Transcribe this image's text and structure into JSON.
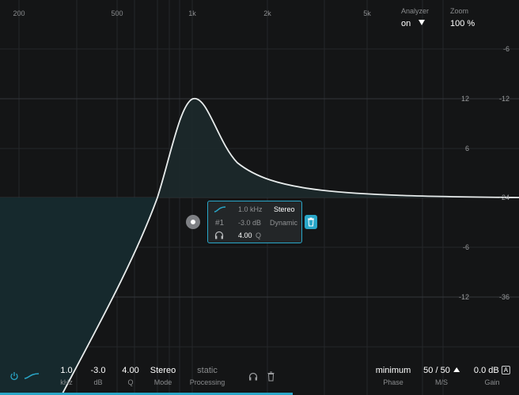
{
  "freq_labels": [
    "200",
    "500",
    "1k",
    "2k",
    "5k"
  ],
  "db_inner": [
    "12",
    "6",
    "-6",
    "-12"
  ],
  "db_outer": [
    "-6",
    "-12",
    "-24",
    "-36"
  ],
  "analyzer": {
    "label": "Analyzer",
    "value": "on"
  },
  "zoom": {
    "label": "Zoom",
    "value": "100 %"
  },
  "band": {
    "freq": "1.0 kHz",
    "channel": "Stereo",
    "index": "#1",
    "gain": "-3.0 dB",
    "mode": "Dynamic",
    "q_value": "4.00",
    "q_label": "Q"
  },
  "bottom": {
    "freq_value": "1.0",
    "freq_label": "kHz",
    "gain_value": "-3.0",
    "gain_label": "dB",
    "q_value": "4.00",
    "q_label": "Q",
    "mode_value": "Stereo",
    "mode_label": "Mode",
    "processing_value": "static",
    "processing_label": "Processing",
    "phase_value": "minimum",
    "phase_label": "Phase",
    "ms_value": "50 / 50",
    "ms_label": "M/S",
    "output_value": "0.0 dB",
    "output_badge": "A",
    "output_label": "Gain"
  },
  "colors": {
    "accent": "#2aa7c8",
    "background": "#141516",
    "curve": "#e8ecec"
  }
}
